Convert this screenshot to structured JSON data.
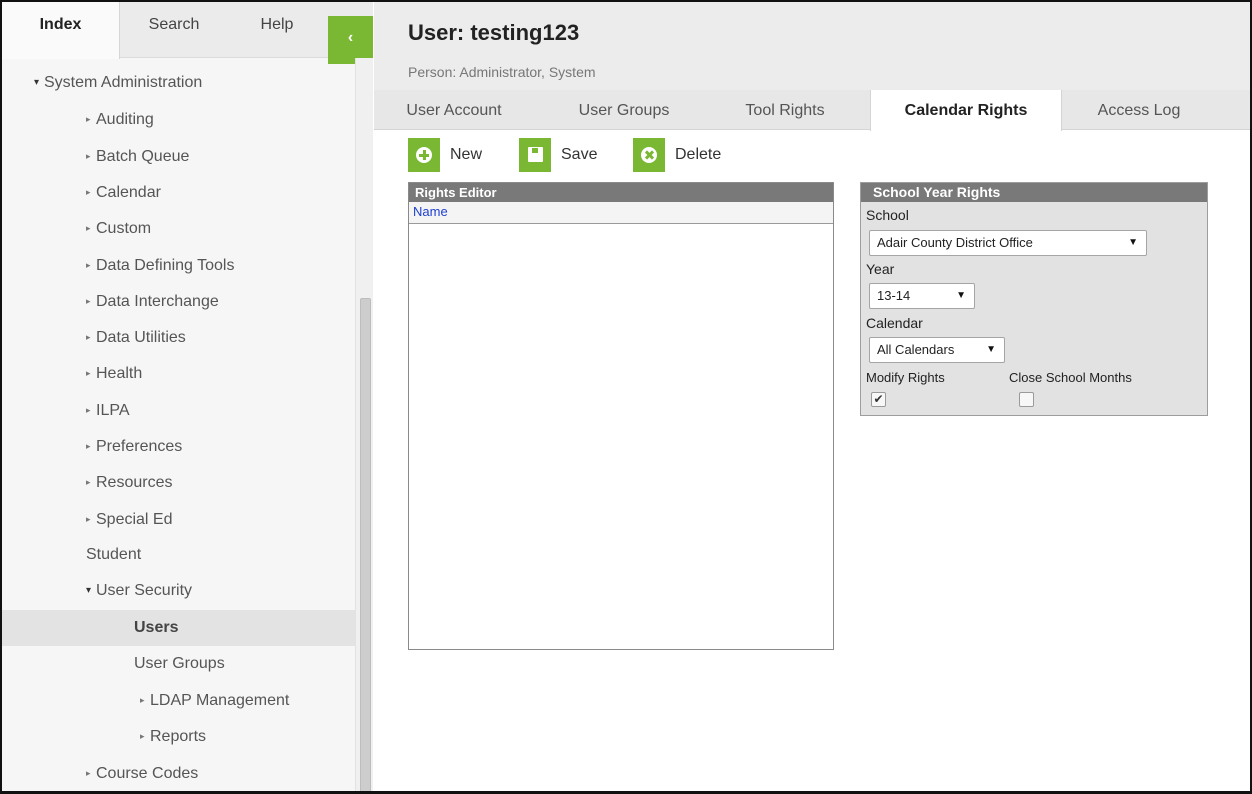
{
  "sidebar": {
    "tabs": [
      "Index",
      "Search",
      "Help"
    ],
    "collapse_glyph": "‹",
    "tree": [
      {
        "label": "System Administration",
        "state": "open"
      },
      {
        "label": "Auditing",
        "state": "closed"
      },
      {
        "label": "Batch Queue",
        "state": "closed"
      },
      {
        "label": "Calendar",
        "state": "closed"
      },
      {
        "label": "Custom",
        "state": "closed"
      },
      {
        "label": "Data Defining Tools",
        "state": "closed"
      },
      {
        "label": "Data Interchange",
        "state": "closed"
      },
      {
        "label": "Data Utilities",
        "state": "closed"
      },
      {
        "label": "Health",
        "state": "closed"
      },
      {
        "label": "ILPA",
        "state": "closed"
      },
      {
        "label": "Preferences",
        "state": "closed"
      },
      {
        "label": "Resources",
        "state": "closed"
      },
      {
        "label": "Special Ed",
        "state": "closed"
      },
      {
        "label": "Student",
        "state": "leaf"
      },
      {
        "label": "User Security",
        "state": "open"
      },
      {
        "label": "Users",
        "state": "selected"
      },
      {
        "label": "User Groups",
        "state": "leaf"
      },
      {
        "label": "LDAP Management",
        "state": "closed"
      },
      {
        "label": "Reports",
        "state": "closed"
      },
      {
        "label": "Course Codes",
        "state": "closed"
      }
    ],
    "arrow_closed": "▸",
    "arrow_open": "▾"
  },
  "header": {
    "title": "User: testing123",
    "subtitle": "Person: Administrator, System"
  },
  "tabs": [
    "User Account",
    "User Groups",
    "Tool Rights",
    "Calendar Rights",
    "Access Log"
  ],
  "toolbar": {
    "new_label": "New",
    "save_label": "Save",
    "delete_label": "Delete"
  },
  "rights_editor": {
    "title": "Rights Editor",
    "column": "Name"
  },
  "school_year_rights": {
    "title": "School Year Rights",
    "school_label": "School",
    "school_value": "Adair County District Office",
    "year_label": "Year",
    "year_value": "13-14",
    "calendar_label": "Calendar",
    "calendar_value": "All Calendars",
    "modify_rights_label": "Modify Rights",
    "modify_rights_checked": true,
    "close_months_label": "Close School Months",
    "close_months_checked": false,
    "caret": "▼",
    "check_glyph": "✔"
  },
  "colors": {
    "accent_green": "#7ab834",
    "panel_header": "#797979",
    "link_blue": "#1d3fcf"
  }
}
